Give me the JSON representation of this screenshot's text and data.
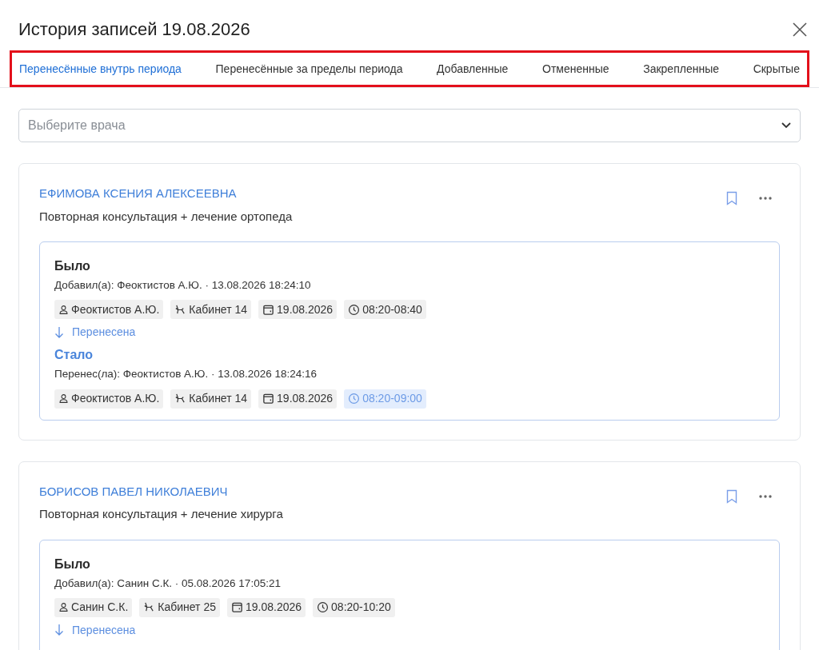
{
  "dialog": {
    "title": "История записей 19.08.2026"
  },
  "tabs": [
    {
      "label": "Перенесённые внутрь периода",
      "selected": true
    },
    {
      "label": "Перенесённые за пределы периода",
      "selected": false
    },
    {
      "label": "Добавленные",
      "selected": false
    },
    {
      "label": "Отмененные",
      "selected": false
    },
    {
      "label": "Закрепленные",
      "selected": false
    },
    {
      "label": "Скрытые",
      "selected": false
    }
  ],
  "doctor_select": {
    "placeholder": "Выберите врача"
  },
  "records": [
    {
      "patient": "ЕФИМОВА КСЕНИЯ АЛЕКСЕЕВНА",
      "service": "Повторная консультация + лечение ортопеда",
      "states": [
        {
          "kind": "before",
          "heading": "Было",
          "meta": "Добавил(а): Феоктистов А.Ю. · 13.08.2026 18:24:10",
          "chips": [
            {
              "kind": "person",
              "text": "Феоктистов А.Ю.",
              "changed": false
            },
            {
              "kind": "chair",
              "text": "Кабинет 14",
              "changed": false
            },
            {
              "kind": "date",
              "text": "19.08.2026",
              "changed": false
            },
            {
              "kind": "time",
              "text": "08:20-08:40",
              "changed": false
            }
          ],
          "transition": "Перенесена"
        },
        {
          "kind": "after",
          "heading": "Стало",
          "meta": "Перенес(ла): Феоктистов А.Ю. · 13.08.2026 18:24:16",
          "chips": [
            {
              "kind": "person",
              "text": "Феоктистов А.Ю.",
              "changed": false
            },
            {
              "kind": "chair",
              "text": "Кабинет 14",
              "changed": false
            },
            {
              "kind": "date",
              "text": "19.08.2026",
              "changed": false
            },
            {
              "kind": "time",
              "text": "08:20-09:00",
              "changed": true
            }
          ]
        }
      ]
    },
    {
      "patient": "БОРИСОВ ПАВЕЛ НИКОЛАЕВИЧ",
      "service": "Повторная консультация + лечение хирурга",
      "states": [
        {
          "kind": "before",
          "heading": "Было",
          "meta": "Добавил(а): Санин С.К. · 05.08.2026 17:05:21",
          "chips": [
            {
              "kind": "person",
              "text": "Санин С.К.",
              "changed": false
            },
            {
              "kind": "chair",
              "text": "Кабинет 25",
              "changed": false
            },
            {
              "kind": "date",
              "text": "19.08.2026",
              "changed": false
            },
            {
              "kind": "time",
              "text": "08:20-10:20",
              "changed": false
            }
          ],
          "transition": "Перенесена"
        }
      ]
    }
  ]
}
